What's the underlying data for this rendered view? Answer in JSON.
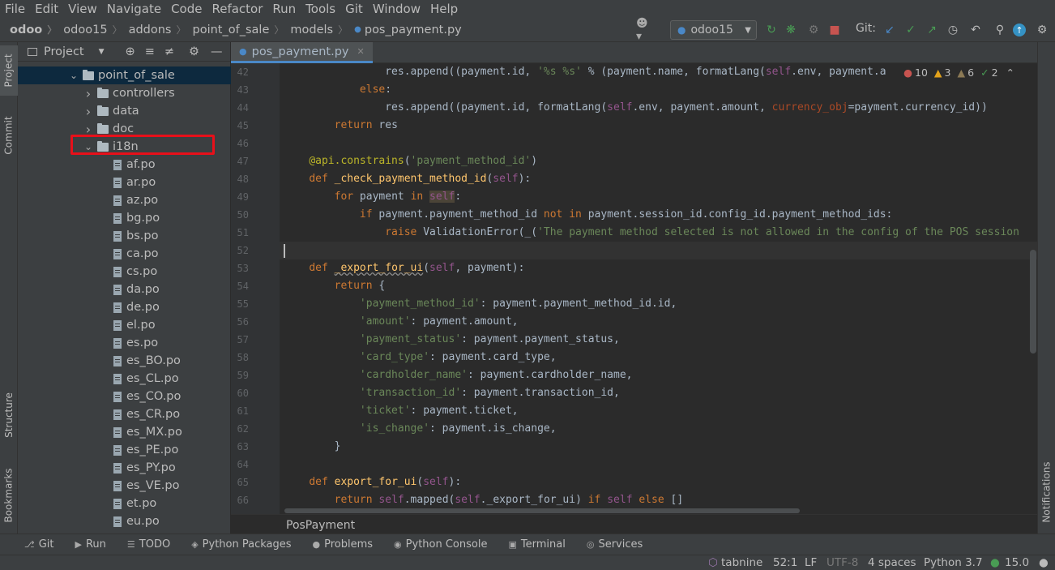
{
  "menu": [
    "File",
    "Edit",
    "View",
    "Navigate",
    "Code",
    "Refactor",
    "Run",
    "Tools",
    "Git",
    "Window",
    "Help"
  ],
  "breadcrumb": [
    "odoo",
    "odoo15",
    "addons",
    "point_of_sale",
    "models",
    "pos_payment.py"
  ],
  "run_config": "odoo15",
  "git_label": "Git:",
  "project": {
    "title": "Project",
    "tree": [
      {
        "label": "point_of_sale",
        "kind": "folder",
        "open": true,
        "indent": 0
      },
      {
        "label": "controllers",
        "kind": "folder",
        "open": false,
        "indent": 1
      },
      {
        "label": "data",
        "kind": "folder",
        "open": false,
        "indent": 1
      },
      {
        "label": "doc",
        "kind": "folder",
        "open": false,
        "indent": 1
      },
      {
        "label": "i18n",
        "kind": "folder",
        "open": true,
        "indent": 1
      },
      {
        "label": "af.po",
        "kind": "file",
        "indent": 2
      },
      {
        "label": "ar.po",
        "kind": "file",
        "indent": 2
      },
      {
        "label": "az.po",
        "kind": "file",
        "indent": 2
      },
      {
        "label": "bg.po",
        "kind": "file",
        "indent": 2
      },
      {
        "label": "bs.po",
        "kind": "file",
        "indent": 2
      },
      {
        "label": "ca.po",
        "kind": "file",
        "indent": 2
      },
      {
        "label": "cs.po",
        "kind": "file",
        "indent": 2
      },
      {
        "label": "da.po",
        "kind": "file",
        "indent": 2
      },
      {
        "label": "de.po",
        "kind": "file",
        "indent": 2
      },
      {
        "label": "el.po",
        "kind": "file",
        "indent": 2
      },
      {
        "label": "es.po",
        "kind": "file",
        "indent": 2
      },
      {
        "label": "es_BO.po",
        "kind": "file",
        "indent": 2
      },
      {
        "label": "es_CL.po",
        "kind": "file",
        "indent": 2
      },
      {
        "label": "es_CO.po",
        "kind": "file",
        "indent": 2
      },
      {
        "label": "es_CR.po",
        "kind": "file",
        "indent": 2
      },
      {
        "label": "es_MX.po",
        "kind": "file",
        "indent": 2
      },
      {
        "label": "es_PE.po",
        "kind": "file",
        "indent": 2
      },
      {
        "label": "es_PY.po",
        "kind": "file",
        "indent": 2
      },
      {
        "label": "es_VE.po",
        "kind": "file",
        "indent": 2
      },
      {
        "label": "et.po",
        "kind": "file",
        "indent": 2
      },
      {
        "label": "eu.po",
        "kind": "file",
        "indent": 2
      }
    ]
  },
  "left_tabs": {
    "project": "Project",
    "commit": "Commit",
    "structure": "Structure",
    "bookmarks": "Bookmarks"
  },
  "right_tabs": {
    "notifications": "Notifications"
  },
  "editor": {
    "tab": "pos_payment.py",
    "inspections": {
      "errors": "10",
      "warnings": "3",
      "weak": "6",
      "ok": "2"
    },
    "lines": [
      {
        "n": "42",
        "html": "                res.append((payment.id, <span class='s'>'%s %s'</span> % (payment.name, formatLang(<span class='sf'>self</span>.env, payment.a"
      },
      {
        "n": "43",
        "html": "            <span class='k'>else</span>:"
      },
      {
        "n": "44",
        "html": "                res.append((payment.id, formatLang(<span class='sf'>self</span>.env, payment.amount, <span class='p'>currency_obj</span>=payment.currency_id))"
      },
      {
        "n": "45",
        "html": "        <span class='k'>return</span> res"
      },
      {
        "n": "46",
        "html": ""
      },
      {
        "n": "47",
        "html": "    <span class='d'>@api.constrains</span>(<span class='s'>'payment_method_id'</span>)"
      },
      {
        "n": "48",
        "html": "    <span class='k'>def</span> <span class='f'>_check_payment_method_id</span>(<span class='sf'>self</span>):"
      },
      {
        "n": "49",
        "html": "        <span class='k'>for</span> payment <span class='k'>in</span> <span class='sf' style='background:#4b4437'>self</span>:"
      },
      {
        "n": "50",
        "html": "            <span class='k'>if</span> payment.payment_method_id <span class='k'>not in</span> payment.session_id.config_id.payment_method_ids:"
      },
      {
        "n": "51",
        "html": "                <span class='k'>raise</span> ValidationError(_(<span class='s'>'The payment method selected is not allowed in the config of the POS session</span>"
      },
      {
        "n": "52",
        "html": ""
      },
      {
        "n": "53",
        "html": "    <span class='k'>def</span> <span class='f' style='text-decoration:underline wavy #8a8a8a'>_export_for_ui</span>(<span class='sf'>self</span>, payment):"
      },
      {
        "n": "54",
        "html": "        <span class='k'>return</span> {"
      },
      {
        "n": "55",
        "html": "            <span class='s'>'payment_method_id'</span>: payment.payment_method_id.id,"
      },
      {
        "n": "56",
        "html": "            <span class='s'>'amount'</span>: payment.amount,"
      },
      {
        "n": "57",
        "html": "            <span class='s'>'payment_status'</span>: payment.payment_status,"
      },
      {
        "n": "58",
        "html": "            <span class='s'>'card_type'</span>: payment.card_type,"
      },
      {
        "n": "59",
        "html": "            <span class='s'>'cardholder_name'</span>: payment.cardholder_name,"
      },
      {
        "n": "60",
        "html": "            <span class='s'>'transaction_id'</span>: payment.transaction_id,"
      },
      {
        "n": "61",
        "html": "            <span class='s'>'ticket'</span>: payment.ticket,"
      },
      {
        "n": "62",
        "html": "            <span class='s'>'is_change'</span>: payment.is_change,"
      },
      {
        "n": "63",
        "html": "        }"
      },
      {
        "n": "64",
        "html": ""
      },
      {
        "n": "65",
        "html": "    <span class='k'>def</span> <span class='f'>export_for_ui</span>(<span class='sf'>self</span>):"
      },
      {
        "n": "66",
        "html": "        <span class='k'>return</span> <span class='sf'>self</span>.mapped(<span class='sf'>self</span>._export_for_ui) <span class='k'>if</span> <span class='sf'>self</span> <span class='k'>else</span> []"
      }
    ],
    "class_breadcrumb": "PosPayment"
  },
  "bottom_tools": [
    "Git",
    "Run",
    "TODO",
    "Python Packages",
    "Problems",
    "Python Console",
    "Terminal",
    "Services"
  ],
  "status": {
    "tabnine": "tabnine",
    "position": "52:1",
    "line_sep": "LF",
    "encoding": "UTF-8",
    "indent": "4 spaces",
    "interpreter": "Python 3.7",
    "python_version": "15.0"
  }
}
